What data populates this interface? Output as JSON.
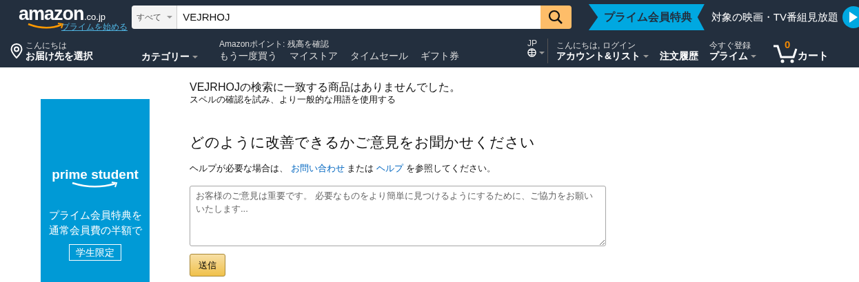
{
  "header": {
    "logo": {
      "wordmark": "amazon",
      "suffix": ".co.jp",
      "prime_link": "プライムを始める"
    },
    "search": {
      "category": "すべて",
      "value": "VEJRHOJ"
    },
    "prime_banner": {
      "badge": "プライム会員特典",
      "text": "対象の映画・TV番組見放題"
    }
  },
  "nav": {
    "deliver": {
      "greeting": "こんにちは",
      "label": "お届け先を選択"
    },
    "category": "カテゴリー",
    "points": "Amazonポイント: 残高を確認",
    "links": [
      "もう一度買う",
      "マイストア",
      "タイムセール",
      "ギフト券"
    ],
    "language": "JP",
    "account": {
      "greeting": "こんにちは, ログイン",
      "label": "アカウント&リスト"
    },
    "orders": "注文履歴",
    "prime": {
      "greeting": "今すぐ登録",
      "label": "プライム"
    },
    "cart": {
      "count": "0",
      "label": "カート"
    }
  },
  "ad": {
    "brand": "prime student",
    "lines": [
      "プライム会員特典を",
      "通常会員費の半額で"
    ],
    "badge": "学生限定"
  },
  "results": {
    "message": "VEJRHOJの検索に一致する商品はありませんでした。",
    "suggestion": "スペルの確認を試み、より一般的な用語を使用する",
    "feedback_title": "どのように改善できるかご意見をお聞かせください",
    "help": [
      {
        "kind": "text",
        "text": "ヘルプが必要な場合は、"
      },
      {
        "kind": "link",
        "text": "お問い合わせ"
      },
      {
        "kind": "text",
        "text": "または"
      },
      {
        "kind": "link",
        "text": "ヘルプ"
      },
      {
        "kind": "text",
        "text": "を参照してください。"
      }
    ],
    "feedback_placeholder": "お客様のご意見は重要です。 必要なものをより簡単に見つけるようにするために、ご協力をお願いいたします...",
    "submit": "送信"
  }
}
